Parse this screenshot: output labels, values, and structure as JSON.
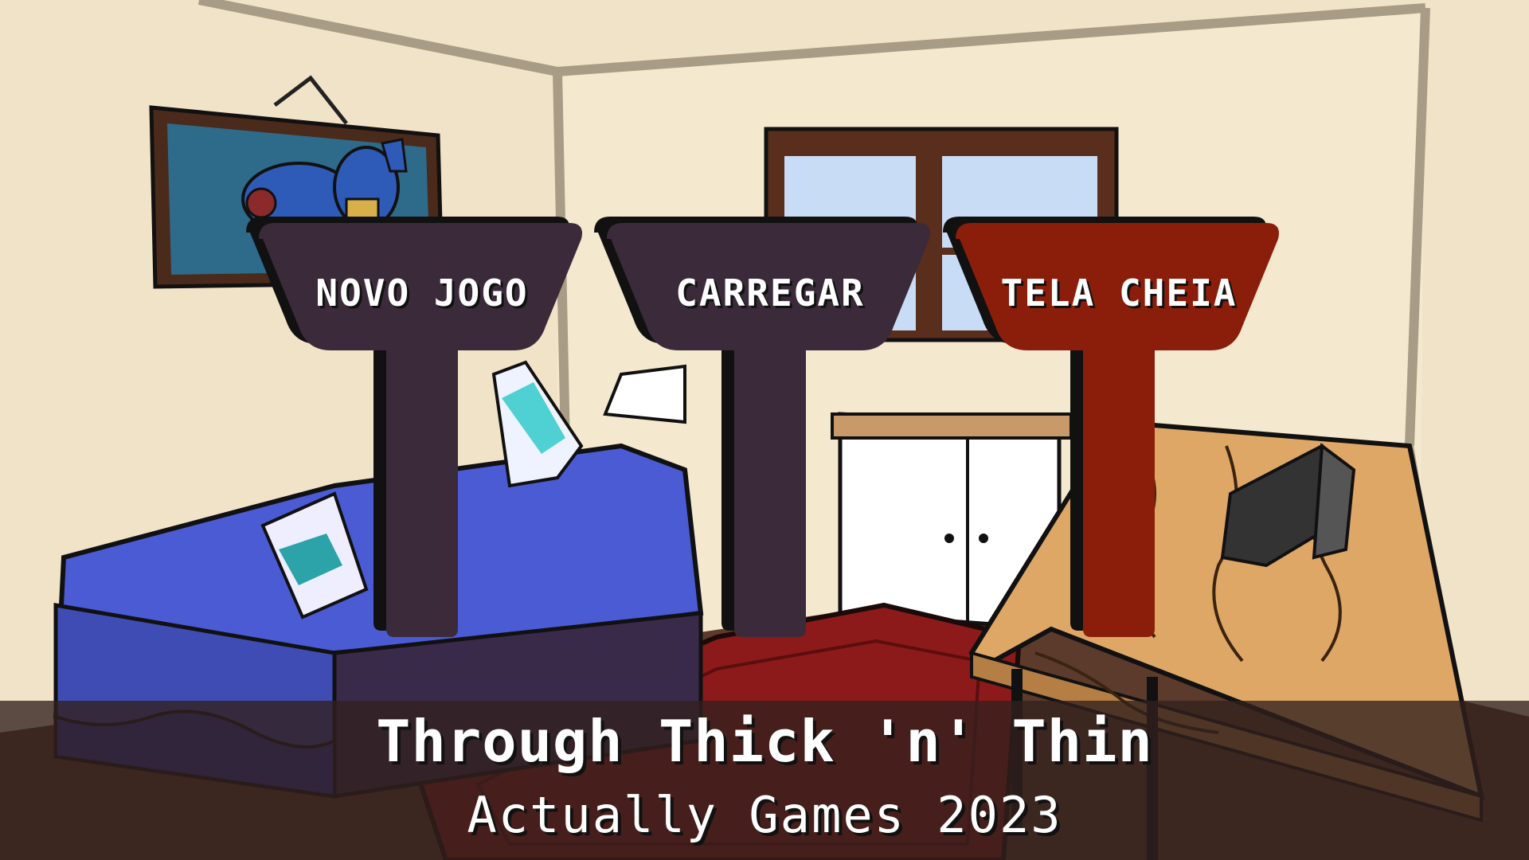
{
  "menu": {
    "new_game": "NOVO JOGO",
    "load": "CARREGAR",
    "fullscreen": "TELA CHEIA"
  },
  "footer": {
    "title": "Through Thick 'n' Thin",
    "credit": "Actually Games 2023"
  },
  "colors": {
    "wall": "#f1e3c8",
    "button_default": "#3a2a3a",
    "button_selected": "#8b1e0a",
    "bed_blue": "#4a5bd4",
    "rug_red": "#8c1a1a",
    "desk_wood": "#dfa765",
    "footer_overlay": "#32201e"
  },
  "selected_button": "fullscreen"
}
